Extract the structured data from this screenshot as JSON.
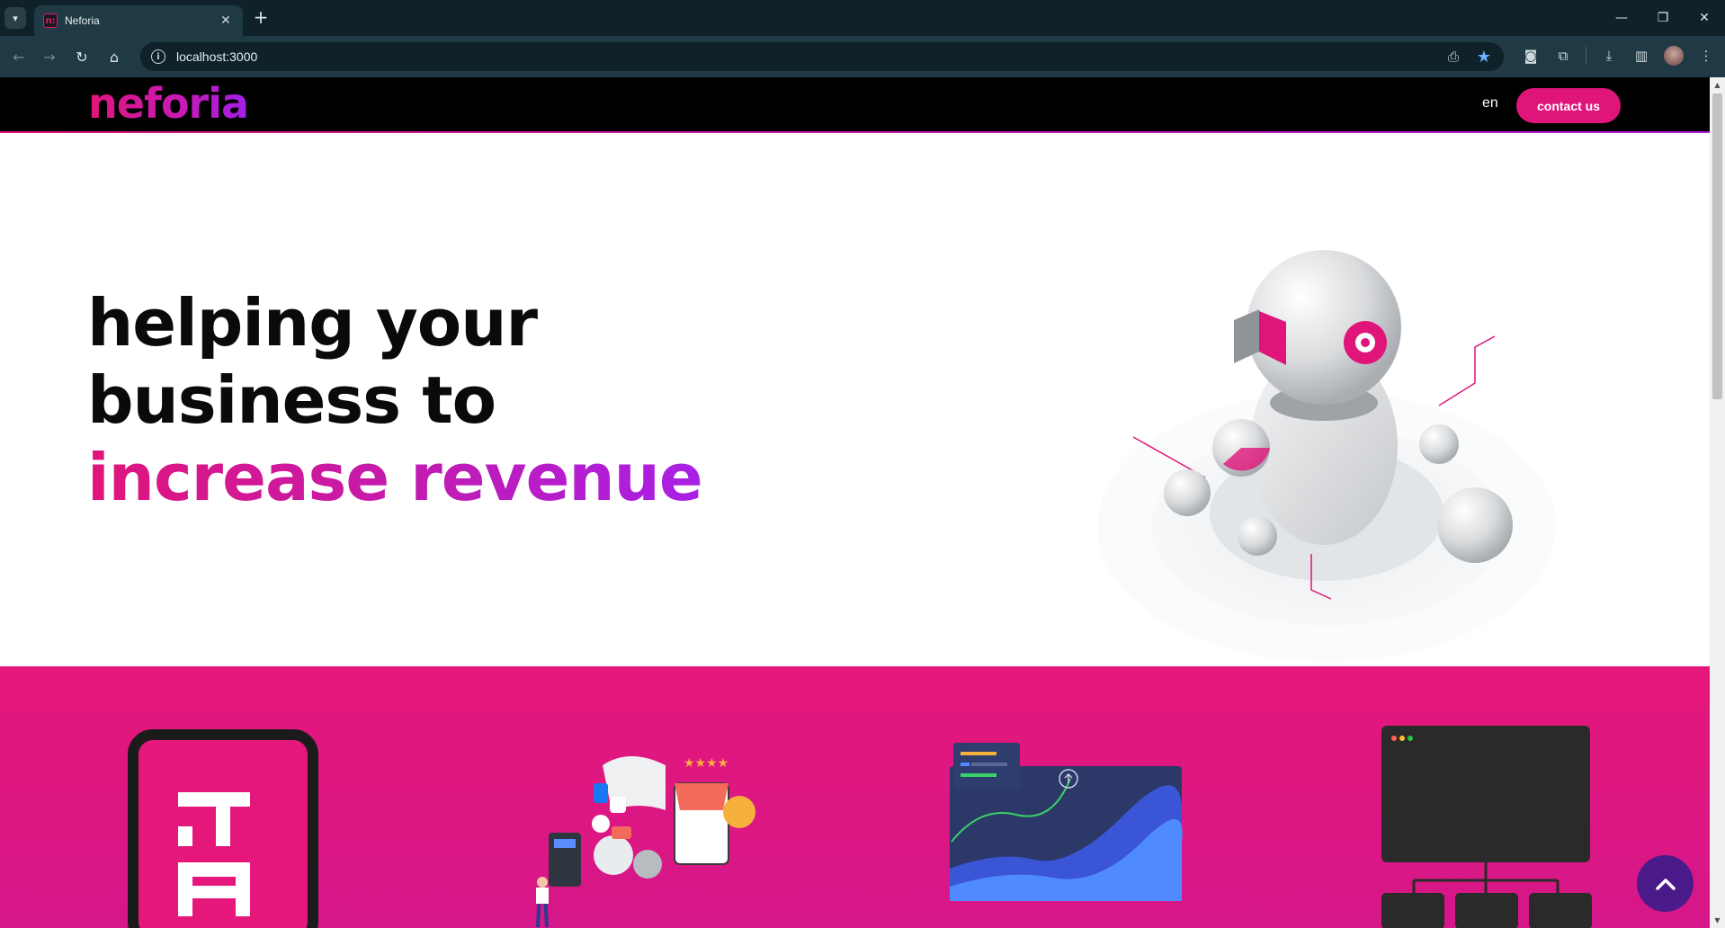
{
  "browser": {
    "tab_title": "Neforia",
    "tab_favicon_text": "n:",
    "url": "localhost:3000"
  },
  "site": {
    "logo": "neforia",
    "language": "en",
    "contact_label": "contact us"
  },
  "hero": {
    "line1": "helping your",
    "line2": "business to",
    "line3": "increase revenue"
  },
  "colors": {
    "brand_pink": "#e0157a",
    "brand_purple": "#a820e6",
    "chrome_dark": "#0f2129",
    "scroll_top_bg": "#4b1a8a"
  },
  "icons": {
    "scroll_top": "chevron-up-icon"
  }
}
